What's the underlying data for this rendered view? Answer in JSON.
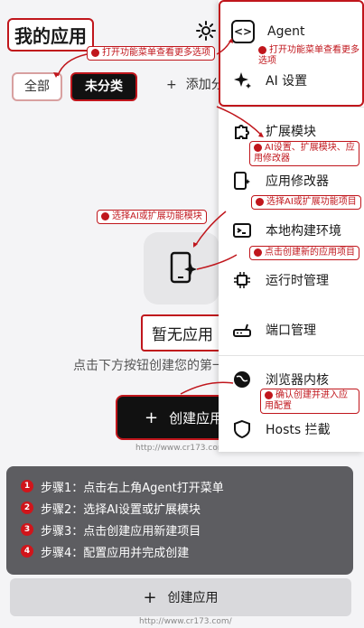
{
  "header": {
    "title": "我的应用"
  },
  "filters": {
    "all": "全部",
    "uncategorized": "未分类",
    "add_plus": "+",
    "add_label": "添加分类"
  },
  "empty": {
    "title": "暂无应用",
    "desc": "点击下方按钮创建您的第一个应用"
  },
  "create": {
    "plus": "+",
    "label": "创建应用"
  },
  "watermark": "http://www.cr173.com/",
  "menu": {
    "items": [
      {
        "label": "Agent",
        "icon": "agent-icon"
      },
      {
        "label": "AI 设置",
        "icon": "sparkle-icon"
      },
      {
        "label": "扩展模块",
        "icon": "puzzle-icon"
      },
      {
        "label": "应用修改器",
        "icon": "phone-sparkle-icon"
      },
      {
        "label": "本地构建环境",
        "icon": "terminal-icon"
      },
      {
        "label": "运行时管理",
        "icon": "chip-icon"
      },
      {
        "label": "端口管理",
        "icon": "router-icon"
      },
      {
        "label": "浏览器内核",
        "icon": "globe-icon"
      },
      {
        "label": "Hosts 拦截",
        "icon": "shield-icon"
      }
    ]
  },
  "annotations": {
    "open_menu_left": "打开功能菜单查看更多选项",
    "open_menu_right": "打开功能菜单查看更多选项",
    "ai_settings_ext": "AI设置、扩展模块、应用修改器",
    "choose_ai_right": "选择AI或扩展功能项目",
    "choose_ai_left": "选择AI或扩展功能模块",
    "create_new": "点击创建新的应用项目",
    "confirm_create": "确认创建并进入应用配置"
  },
  "steps": [
    {
      "num": "1",
      "text": "步骤1：点击右上角Agent打开菜单"
    },
    {
      "num": "2",
      "text": "步骤2：选择AI设置或扩展模块"
    },
    {
      "num": "3",
      "text": "步骤3：点击创建应用新建项目"
    },
    {
      "num": "4",
      "text": "步骤4：配置应用并完成创建"
    }
  ],
  "colors": {
    "accent": "#c0161c",
    "dark": "#111111",
    "panel": "#5d5d61"
  }
}
